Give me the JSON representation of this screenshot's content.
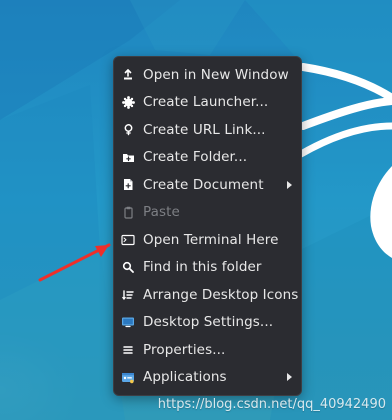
{
  "menu": {
    "items": [
      {
        "label": "Open in New Window",
        "icon": "open-window-icon"
      },
      {
        "label": "Create Launcher...",
        "icon": "launcher-icon"
      },
      {
        "label": "Create URL Link...",
        "icon": "link-icon"
      },
      {
        "label": "Create Folder...",
        "icon": "folder-icon"
      },
      {
        "label": "Create Document",
        "icon": "document-icon"
      },
      {
        "label": "Paste",
        "icon": "paste-icon"
      },
      {
        "label": "Open Terminal Here",
        "icon": "terminal-icon"
      },
      {
        "label": "Find in this folder",
        "icon": "search-icon"
      },
      {
        "label": "Arrange Desktop Icons",
        "icon": "arrange-icon"
      },
      {
        "label": "Desktop Settings...",
        "icon": "desktop-settings-icon"
      },
      {
        "label": "Properties...",
        "icon": "properties-icon"
      },
      {
        "label": "Applications",
        "icon": "applications-icon"
      }
    ]
  },
  "overlay": {
    "watermark": "https://blog.csdn.net/qq_40942490"
  },
  "colors": {
    "menu_background": "#2b2c31",
    "menu_text": "#e8e8e8",
    "disabled_text": "#7d7f84",
    "desktop_blue": "#1f8ec3",
    "arrow_red": "#ef2f2a"
  }
}
